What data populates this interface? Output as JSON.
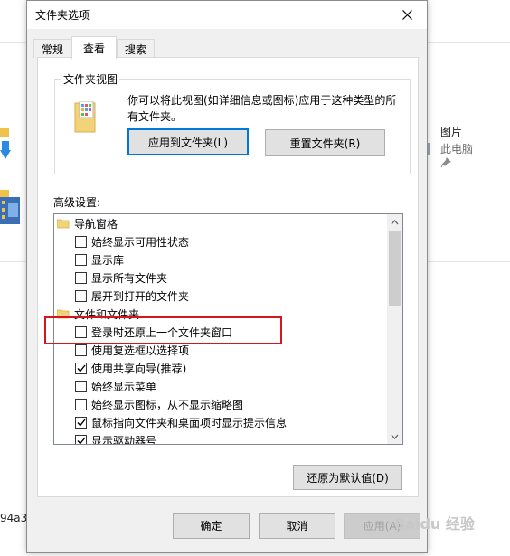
{
  "background": {
    "pictures_title": "图片",
    "pictures_subtitle": "此电脑",
    "partial_text": "94a3"
  },
  "dialog": {
    "title": "文件夹选项",
    "tabs": [
      {
        "label": "常规",
        "active": false
      },
      {
        "label": "查看",
        "active": true
      },
      {
        "label": "搜索",
        "active": false
      }
    ],
    "folder_views": {
      "label": "文件夹视图",
      "description": "你可以将此视图(如详细信息或图标)应用于这种类型的所有文件夹。",
      "apply_button": "应用到文件夹(L)",
      "reset_button": "重置文件夹(R)"
    },
    "advanced_label": "高级设置:",
    "tree": [
      {
        "type": "folder",
        "label": "导航窗格"
      },
      {
        "type": "check",
        "label": "始终显示可用性状态",
        "checked": false
      },
      {
        "type": "check",
        "label": "显示库",
        "checked": false
      },
      {
        "type": "check",
        "label": "显示所有文件夹",
        "checked": false
      },
      {
        "type": "check",
        "label": "展开到打开的文件夹",
        "checked": false
      },
      {
        "type": "folder",
        "label": "文件和文件夹"
      },
      {
        "type": "check",
        "label": "登录时还原上一个文件夹窗口",
        "checked": false
      },
      {
        "type": "check",
        "label": "使用复选框以选择项",
        "checked": false
      },
      {
        "type": "check",
        "label": "使用共享向导(推荐)",
        "checked": true
      },
      {
        "type": "check",
        "label": "始终显示菜单",
        "checked": false
      },
      {
        "type": "check",
        "label": "始终显示图标，从不显示缩略图",
        "checked": false
      },
      {
        "type": "check",
        "label": "鼠标指向文件夹和桌面项时显示提示信息",
        "checked": true
      },
      {
        "type": "check",
        "label": "显示驱动器号",
        "checked": true
      }
    ],
    "restore_defaults_button": "还原为默认值(D)",
    "ok_button": "确定",
    "cancel_button": "取消",
    "apply_button": "应用(A)"
  },
  "watermark": "Baidu 经验",
  "colors": {
    "highlight_border": "#d4161f",
    "default_button_border": "#0078d7",
    "dialog_bg": "#f0f0f0"
  }
}
